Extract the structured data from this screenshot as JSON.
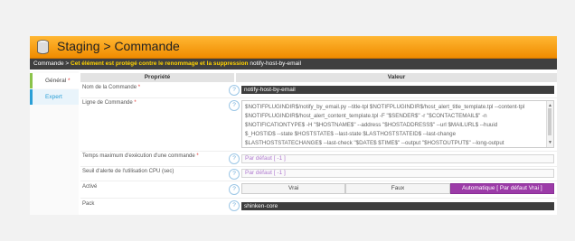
{
  "header": {
    "title": "Staging > Commande"
  },
  "breadcrumb": {
    "prefix": "Commande > ",
    "warning": "Cet élément est protégé contre le renommage et la suppression",
    "item": " notify-host-by-email"
  },
  "tabs": [
    {
      "label": "Général",
      "required_mark": "*"
    },
    {
      "label": "Expert"
    }
  ],
  "table": {
    "col_property": "Propriété",
    "col_value": "Valeur"
  },
  "help_glyph": "?",
  "fields": {
    "command_name": {
      "label": "Nom de la Commande",
      "required_mark": "*",
      "value": "notify-host-by-email"
    },
    "command_line": {
      "label": "Ligne de Commande",
      "required_mark": "*",
      "lines": [
        "$NOTIFPLUGINDIR$/notify_by_email.py --title-tpl $NOTIFPLUGINDIR$/host_alert_title_template.tpl --content-tpl",
        "$NOTIFPLUGINDIR$/host_alert_content_template.tpl -F \"$SENDER$\" -r \"$CONTACTEMAIL$\" -n",
        "$NOTIFICATIONTYPE$ -H \"$HOSTNAME$\" --address \"$HOSTADDRESS$\" --url $MAILURL$ --huuid",
        "$_HOSTID$ --state $HOSTSTATE$ --last-state $LASTHOSTSTATEID$ --last-change",
        "$LASTHOSTSTATECHANGE$  --last-check \"$DATE$ $TIME$\" --output \"$HOSTOUTPUT$\" --long-output"
      ]
    },
    "max_exec_time": {
      "label": "Temps maximum d'exécution d'une commande",
      "required_mark": "*",
      "placeholder": "Par défaut [ -1 ]"
    },
    "cpu_threshold": {
      "label": "Seuil d'alerte de l'utilisation CPU (sec)",
      "placeholder": "Par défaut [ -1 ]"
    },
    "enabled": {
      "label": "Activé",
      "options": [
        "Vrai",
        "Faux",
        "Automatique [ Par défaut Vrai ]"
      ],
      "selected_index": 2
    },
    "pack": {
      "label": "Pack",
      "value": "shinken-core"
    }
  },
  "colors": {
    "header_orange": "#f5a000",
    "selected_purple": "#9c3ba8",
    "general_tab_accent": "#8bc34a",
    "expert_tab_accent": "#2a9fd6"
  }
}
